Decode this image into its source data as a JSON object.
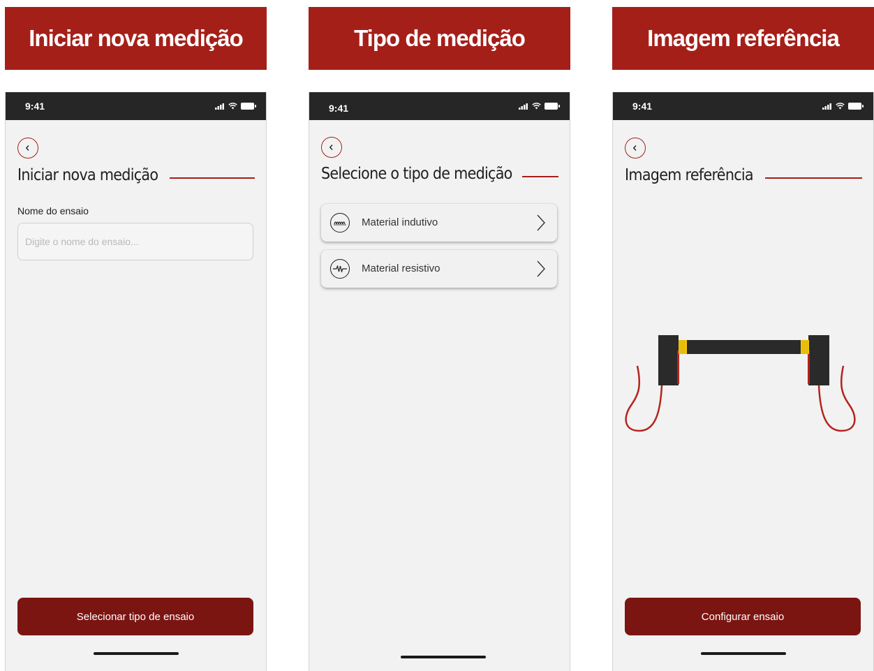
{
  "screens": [
    {
      "banner": "Iniciar nova medição",
      "status_time": "9:41",
      "title": "Iniciar nova medição",
      "field_label": "Nome do ensaio",
      "input_placeholder": "Digite o nome do ensaio...",
      "input_value": "",
      "primary_button": "Selecionar tipo de ensaio"
    },
    {
      "banner": "Tipo de medição",
      "status_time": "9:41",
      "title": "Selecione o tipo de medição",
      "options": [
        {
          "label": "Material indutivo",
          "icon": "inductor-icon"
        },
        {
          "label": "Material resistivo",
          "icon": "resistor-icon"
        }
      ]
    },
    {
      "banner": "Imagem referência",
      "status_time": "9:41",
      "title": "Imagem referência",
      "reference_image": "cable-reference-illustration",
      "primary_button": "Configurar ensaio"
    }
  ],
  "colors": {
    "brand_red": "#a51f19",
    "button_dark_red": "#7b1512",
    "status_bar": "#262626",
    "screen_bg": "#f2f2f2",
    "cable_yellow": "#f1c40f"
  }
}
